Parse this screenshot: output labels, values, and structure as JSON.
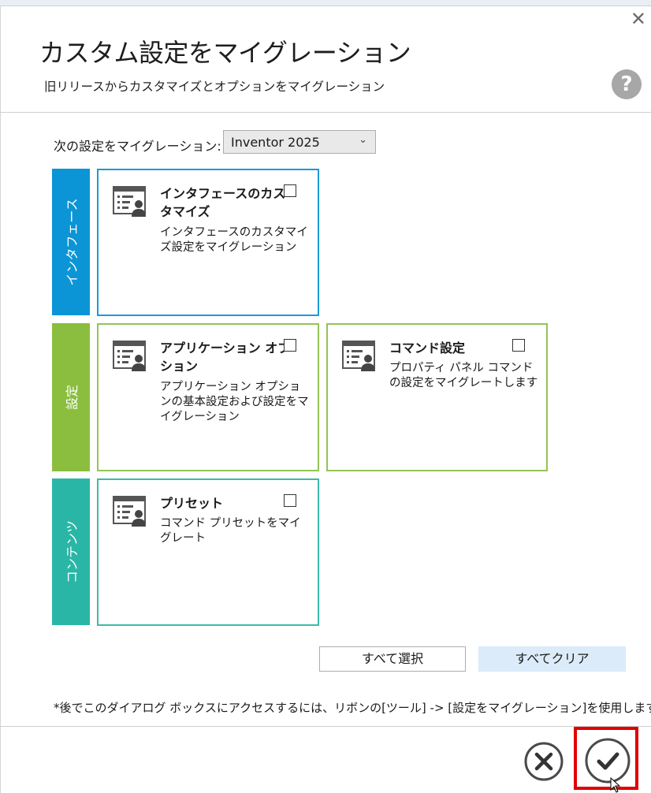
{
  "dialog": {
    "title": "カスタム設定をマイグレーション",
    "subtitle": "旧リリースからカスタマイズとオプションをマイグレーション",
    "close_glyph": "✕",
    "help_glyph": "?"
  },
  "migrate": {
    "label": "次の設定をマイグレーション:",
    "selected": "Inventor 2025"
  },
  "categories": [
    {
      "label": "インタフェース",
      "color": "#0b95d6"
    },
    {
      "label": "設定",
      "color": "#8bbe3e"
    },
    {
      "label": "コンテンツ",
      "color": "#2ab6a6"
    }
  ],
  "cards": {
    "interface": {
      "title": "インタフェースのカスタマイズ",
      "desc": "インタフェースのカスタマイズ設定をマイグレーション",
      "icon": "settings-profile-icon",
      "checked": false
    },
    "app_options": {
      "title": "アプリケーション オプション",
      "desc": "アプリケーション オプションの基本設定および設定をマイグレーション",
      "icon": "settings-profile-icon",
      "checked": false
    },
    "command": {
      "title": "コマンド設定",
      "desc": "プロパティ パネル コマンドの設定をマイグレートします",
      "icon": "settings-profile-icon",
      "checked": false
    },
    "presets": {
      "title": "プリセット",
      "desc": "コマンド プリセットをマイグレート",
      "icon": "settings-profile-icon",
      "checked": false
    }
  },
  "buttons": {
    "select_all": "すべて選択",
    "clear_all": "すべてクリア"
  },
  "footnote": "*後でこのダイアログ ボックスにアクセスするには、リボンの[ツール] -> [設定をマイグレーション]を使用します。",
  "colors": {
    "highlight": "#e00000",
    "blue": "#1c9ad8",
    "green": "#93c456",
    "teal": "#3cbaa8"
  }
}
